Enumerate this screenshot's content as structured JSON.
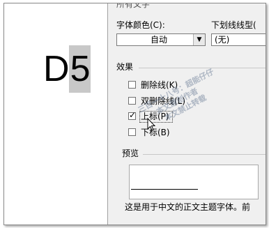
{
  "sheet": {
    "cell_char_1": "D",
    "cell_char_2": "5"
  },
  "dialog": {
    "section_all_text_partial": "所有文字",
    "font_color_label": "字体颜色(C):",
    "font_color_value": "自动",
    "underline_label": "下划线线型(",
    "underline_value": "(无)",
    "effects_label": "效果",
    "effects": [
      {
        "label": "删除线(K)",
        "checked": false
      },
      {
        "label": "双删除线(L)",
        "checked": false
      },
      {
        "label": "上标(P)",
        "checked": true
      },
      {
        "label": "下标(B)",
        "checked": false
      }
    ],
    "preview_label": "预览",
    "preview_caption": "这是用于中文的正文主题字体。前"
  },
  "watermark": {
    "line1": "三百一十八号：超能仔仔",
    "line2": "本文原创作者",
    "line3": "本文禁止转载"
  },
  "colors": {
    "dialog_bg": "#f0f0f0",
    "cell_highlight": "#c8c8c8"
  }
}
